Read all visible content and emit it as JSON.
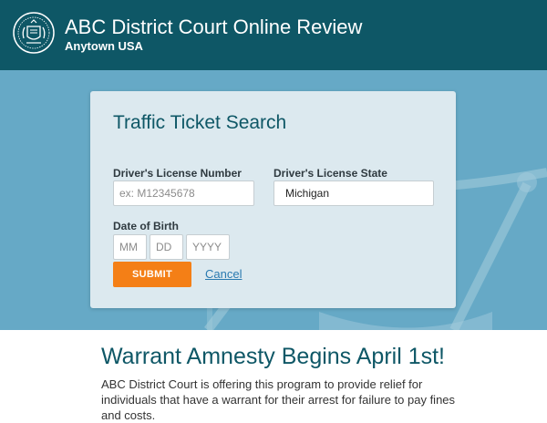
{
  "header": {
    "title": "ABC District Court Online Review",
    "subtitle": "Anytown USA",
    "logo_icon": "court-seal-icon",
    "background": "#0e5766"
  },
  "search_form": {
    "title": "Traffic Ticket Search",
    "license_number": {
      "label": "Driver's License Number",
      "placeholder": "ex: M12345678",
      "value": ""
    },
    "license_state": {
      "label": "Driver's License State",
      "value": "Michigan"
    },
    "dob": {
      "label": "Date of Birth",
      "month_placeholder": "MM",
      "day_placeholder": "DD",
      "year_placeholder": "YYYY"
    },
    "submit_label": "SUBMIT",
    "cancel_label": "Cancel"
  },
  "announcement": {
    "title": "Warrant Amnesty Begins April 1st!",
    "body": "ABC District Court is offering this program to provide relief for individuals that have a warrant for their arrest for failure to pay fines and costs."
  },
  "colors": {
    "brand": "#0e5766",
    "hero": "#66a9c6",
    "accent": "#f47f16",
    "link": "#2a7ab0"
  },
  "background_icon": "scales-of-justice-icon"
}
